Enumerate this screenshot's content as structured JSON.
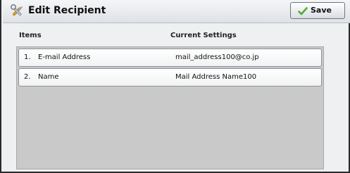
{
  "header": {
    "title": "Edit Recipient",
    "title_icon": "wrench-screwdriver-icon",
    "save_label": "Save",
    "save_icon": "checkmark-icon"
  },
  "columns": {
    "items": "Items",
    "current_settings": "Current Settings"
  },
  "rows": [
    {
      "number": "1.",
      "item": "E-mail Address",
      "value": "mail_address100@co.jp"
    },
    {
      "number": "2.",
      "item": "Name",
      "value": "Mail Address Name100"
    }
  ],
  "colors": {
    "accent_check": "#4caf2f",
    "panel_bg": "#c9c9c9"
  }
}
